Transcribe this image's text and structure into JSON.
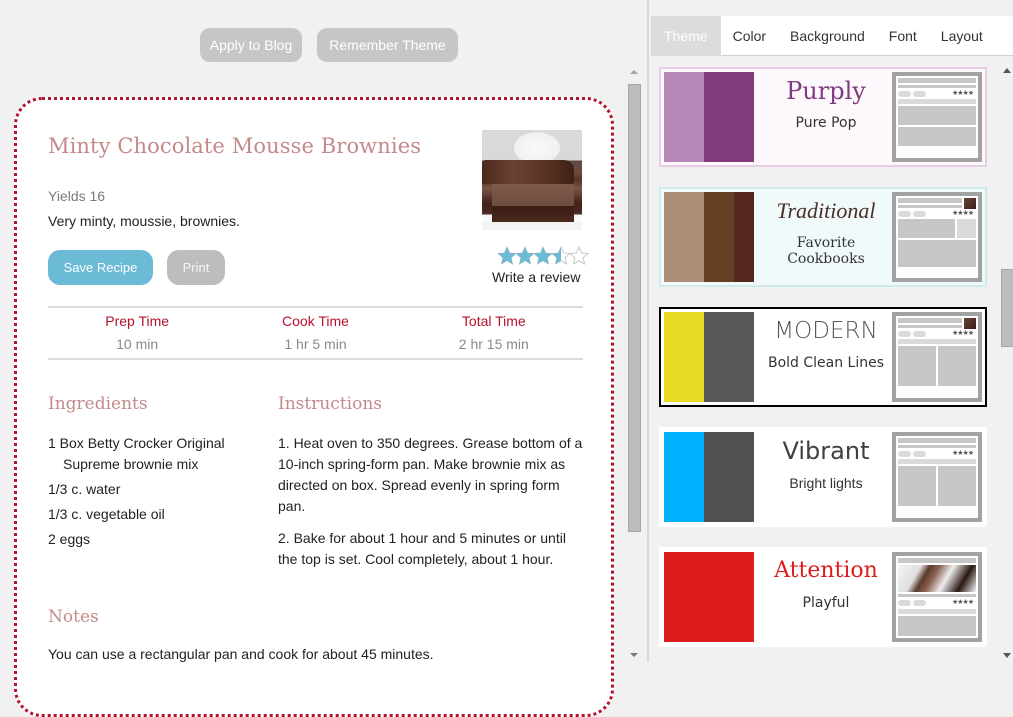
{
  "toolbar": {
    "apply_label": "Apply to Blog",
    "remember_label": "Remember Theme"
  },
  "recipe": {
    "title": "Minty Chocolate Mousse Brownies",
    "yield": "Yields 16",
    "description": "Very minty, moussie, brownies.",
    "image_alt": "Chocolate mousse brownie slice on a white plate",
    "save_label": "Save Recipe",
    "print_label": "Print",
    "rating": 3.5,
    "rating_max": 5,
    "review_link": "Write a review",
    "times": [
      {
        "label": "Prep Time",
        "value": "10 min"
      },
      {
        "label": "Cook Time",
        "value": "1 hr 5 min"
      },
      {
        "label": "Total Time",
        "value": "2 hr 15 min"
      }
    ],
    "ingredients_heading": "Ingredients",
    "ingredients": [
      "1 Box Betty Crocker Original Supreme brownie mix",
      "1/3 c. water",
      "1/3 c. vegetable oil",
      "2 eggs"
    ],
    "instructions_heading": "Instructions",
    "instructions": [
      "1. Heat oven to 350 degrees. Grease bottom of a 10-inch spring-form pan. Make brownie mix as directed on box. Spread evenly in spring form pan.",
      "2. Bake for about 1 hour and 5 minutes or until the top is set. Cool completely, about 1 hour."
    ],
    "notes_heading": "Notes",
    "notes": "You can use a rectangular pan and cook for about 45 minutes."
  },
  "colors": {
    "accent_red": "#b5122c",
    "heading_pink": "#c48a8a",
    "save_blue": "#6bbad6",
    "star_blue": "#6bbad6"
  },
  "panel": {
    "tabs": [
      {
        "label": "Theme",
        "active": true
      },
      {
        "label": "Color",
        "active": false
      },
      {
        "label": "Background",
        "active": false
      },
      {
        "label": "Font",
        "active": false
      },
      {
        "label": "Layout",
        "active": false
      }
    ],
    "themes": [
      {
        "name": "Purply",
        "subtitle": "Pure Pop",
        "swatches": [
          "#b788b7",
          "#7f3b7e"
        ],
        "name_color": "#7f3b7e",
        "bg": "#fcf8fc",
        "border": "#e8cce6",
        "selected": false
      },
      {
        "name": "Traditional",
        "subtitle": "Favorite Cookbooks",
        "swatches": [
          "#ad8f77",
          "#673f22",
          "#55281d"
        ],
        "name_color": "#4a2f2a",
        "bg": "#f1fafa",
        "border": "#cfeceb",
        "selected": false
      },
      {
        "name": "MODERN",
        "subtitle": "Bold Clean Lines",
        "swatches": [
          "#e9da25",
          "#575757"
        ],
        "name_color": "#555555",
        "bg": "#ffffff",
        "border": "#000000",
        "selected": true
      },
      {
        "name": "Vibrant",
        "subtitle": "Bright lights",
        "swatches": [
          "#00b2fe",
          "#505050"
        ],
        "name_color": "#404040",
        "bg": "#ffffff",
        "border": "#ffffff",
        "selected": false
      },
      {
        "name": "Attention",
        "subtitle": "Playful",
        "swatches": [
          "#dd1c1c"
        ],
        "name_color": "#dd1c1c",
        "bg": "#ffffff",
        "border": "#ffffff",
        "selected": false
      }
    ]
  }
}
